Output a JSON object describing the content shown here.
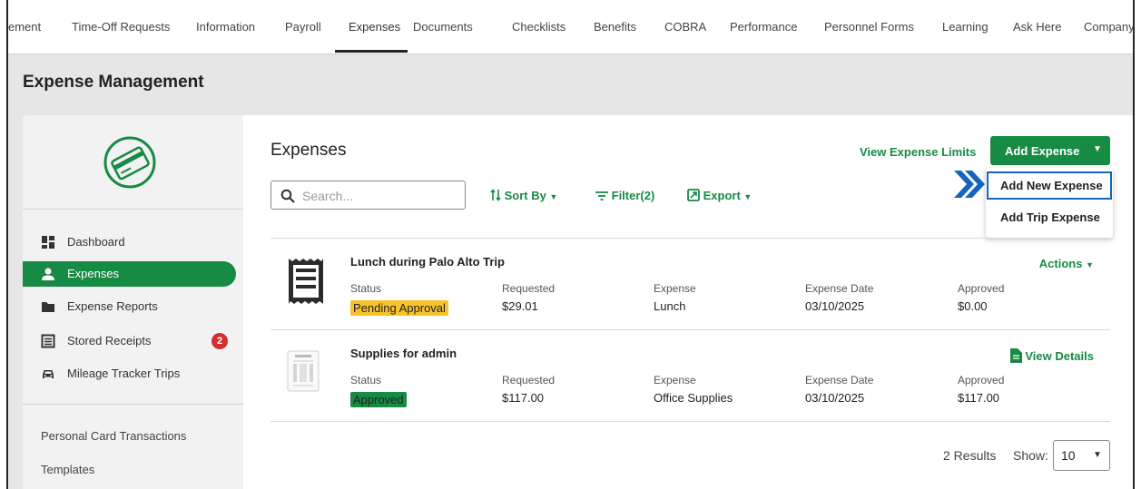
{
  "nav": {
    "tabs": [
      {
        "label": "ement"
      },
      {
        "label": "Time-Off Requests"
      },
      {
        "label": "Information"
      },
      {
        "label": "Payroll"
      },
      {
        "label": "Expenses",
        "active": true
      },
      {
        "label": "Documents"
      },
      {
        "label": "Checklists"
      },
      {
        "label": "Benefits"
      },
      {
        "label": "COBRA"
      },
      {
        "label": "Performance"
      },
      {
        "label": "Personnel Forms"
      },
      {
        "label": "Learning"
      },
      {
        "label": "Ask Here"
      },
      {
        "label": "Company"
      }
    ]
  },
  "page_title": "Expense Management",
  "sidebar": {
    "logo_icon": "credit-card-icon",
    "items": [
      {
        "label": "Dashboard",
        "icon": "dashboard-icon"
      },
      {
        "label": "Expenses",
        "icon": "person-icon",
        "active": true
      },
      {
        "label": "Expense Reports",
        "icon": "folder-icon"
      },
      {
        "label": "Stored Receipts",
        "icon": "receipt-icon",
        "badge": "2"
      },
      {
        "label": "Mileage Tracker Trips",
        "icon": "car-icon"
      }
    ],
    "links": [
      "Personal Card Transactions",
      "Templates"
    ]
  },
  "main": {
    "title": "Expenses",
    "view_limits": "View Expense Limits",
    "add_expense": "Add Expense",
    "dropdown": [
      "Add New Expense",
      "Add Trip Expense"
    ],
    "search_placeholder": "Search...",
    "sort_by": "Sort By",
    "filter": "Filter(2)",
    "export": "Export",
    "rows": [
      {
        "name": "Lunch during Palo Alto Trip",
        "action": "Actions",
        "status": "Pending Approval",
        "requested": "$29.01",
        "expense": "Lunch",
        "date": "03/10/2025",
        "approved": "$0.00"
      },
      {
        "name": "Supplies for admin",
        "action": "View Details",
        "status": "Approved",
        "requested": "$117.00",
        "expense": "Office Supplies",
        "date": "03/10/2025",
        "approved": "$117.00"
      }
    ],
    "col_headers": {
      "status": "Status",
      "requested": "Requested",
      "expense": "Expense",
      "date": "Expense Date",
      "approved": "Approved"
    },
    "results": "2 Results",
    "show_label": "Show:",
    "show_value": "10"
  },
  "colors": {
    "accent": "#178a43",
    "pending": "#f7c32b",
    "badge": "#d32f2f",
    "highlight": "#1565c0"
  }
}
